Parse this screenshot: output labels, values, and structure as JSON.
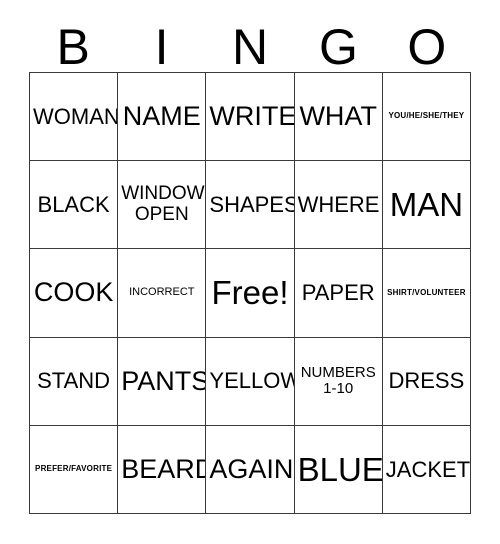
{
  "card": {
    "title": "BINGO",
    "header_letters": [
      "B",
      "I",
      "N",
      "G",
      "O"
    ],
    "border_color": "#3a3a3a",
    "background_color": "#ffffff",
    "text_color": "#000000",
    "columns": 5,
    "rows": 5,
    "free_space_label": "Free!",
    "free_space_position": {
      "row": 3,
      "column": 3
    }
  },
  "grid": {
    "rows": [
      {
        "cells": [
          {
            "text": "WOMAN",
            "size": "md"
          },
          {
            "text": "NAME",
            "size": "lg"
          },
          {
            "text": "WRITE",
            "size": "lg"
          },
          {
            "text": "WHAT",
            "size": "lg"
          },
          {
            "text": "YOU/HE/SHE/THEY",
            "size": "tiny"
          }
        ]
      },
      {
        "cells": [
          {
            "text": "BLACK",
            "size": "md"
          },
          {
            "text": "WINDOW\nOPEN",
            "size": "sm"
          },
          {
            "text": "SHAPES",
            "size": "md"
          },
          {
            "text": "WHERE",
            "size": "md"
          },
          {
            "text": "MAN",
            "size": "xl"
          }
        ]
      },
      {
        "cells": [
          {
            "text": "COOK",
            "size": "lg"
          },
          {
            "text": "INCORRECT",
            "size": "xxs"
          },
          {
            "text": "Free!",
            "size": "xl"
          },
          {
            "text": "PAPER",
            "size": "md"
          },
          {
            "text": "SHIRT/VOLUNTEER",
            "size": "tiny"
          }
        ]
      },
      {
        "cells": [
          {
            "text": "STAND",
            "size": "md"
          },
          {
            "text": "PANTS",
            "size": "lg"
          },
          {
            "text": "YELLOW",
            "size": "md"
          },
          {
            "text": "NUMBERS\n1-10",
            "size": "xs"
          },
          {
            "text": "DRESS",
            "size": "md"
          }
        ]
      },
      {
        "cells": [
          {
            "text": "PREFER/FAVORITE",
            "size": "tiny"
          },
          {
            "text": "BEARD",
            "size": "lg"
          },
          {
            "text": "AGAIN",
            "size": "lg"
          },
          {
            "text": "BLUE",
            "size": "xl"
          },
          {
            "text": "JACKET",
            "size": "md"
          }
        ]
      }
    ]
  }
}
